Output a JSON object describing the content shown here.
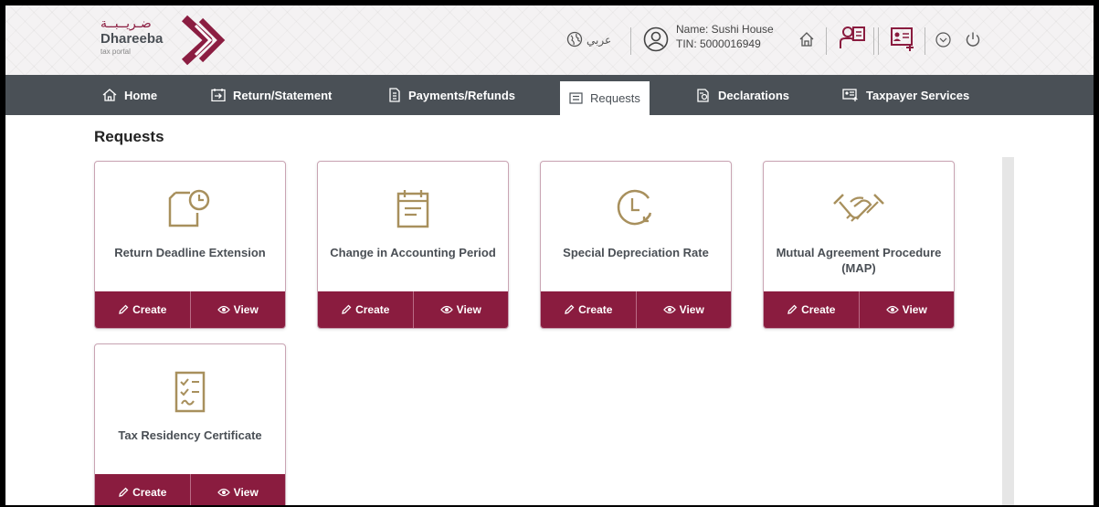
{
  "header": {
    "logo_arabic": "ضـريــبــة",
    "logo_name": "Dhareeba",
    "logo_tagline": "tax portal",
    "language_label": "عربي",
    "taxpayer_name": "Name: Sushi House",
    "taxpayer_tin": "TIN: 5000016949"
  },
  "nav": {
    "items": [
      {
        "label": "Home",
        "icon": "home-icon"
      },
      {
        "label": "Return/Statement",
        "icon": "return-icon"
      },
      {
        "label": "Payments/Refunds",
        "icon": "payments-icon"
      },
      {
        "label": "Requests",
        "icon": "requests-icon"
      },
      {
        "label": "Declarations",
        "icon": "declarations-icon"
      },
      {
        "label": "Taxpayer Services",
        "icon": "services-icon"
      }
    ],
    "active": "Requests"
  },
  "page": {
    "title": "Requests"
  },
  "cards": [
    {
      "title": "Return Deadline Extension",
      "icon": "document-clock-icon",
      "create_label": "Create",
      "view_label": "View"
    },
    {
      "title": "Change in Accounting Period",
      "icon": "calendar-icon",
      "create_label": "Create",
      "view_label": "View"
    },
    {
      "title": "Special Depreciation Rate",
      "icon": "clock-arrow-icon",
      "create_label": "Create",
      "view_label": "View"
    },
    {
      "title": "Mutual Agreement Procedure (MAP)",
      "icon": "handshake-icon",
      "create_label": "Create",
      "view_label": "View"
    },
    {
      "title": "Tax Residency Certificate",
      "icon": "checklist-icon",
      "create_label": "Create",
      "view_label": "View"
    }
  ],
  "colors": {
    "brand_maroon": "#8a1c3f",
    "nav_gray": "#4a5056",
    "icon_gold": "#a8905d"
  }
}
